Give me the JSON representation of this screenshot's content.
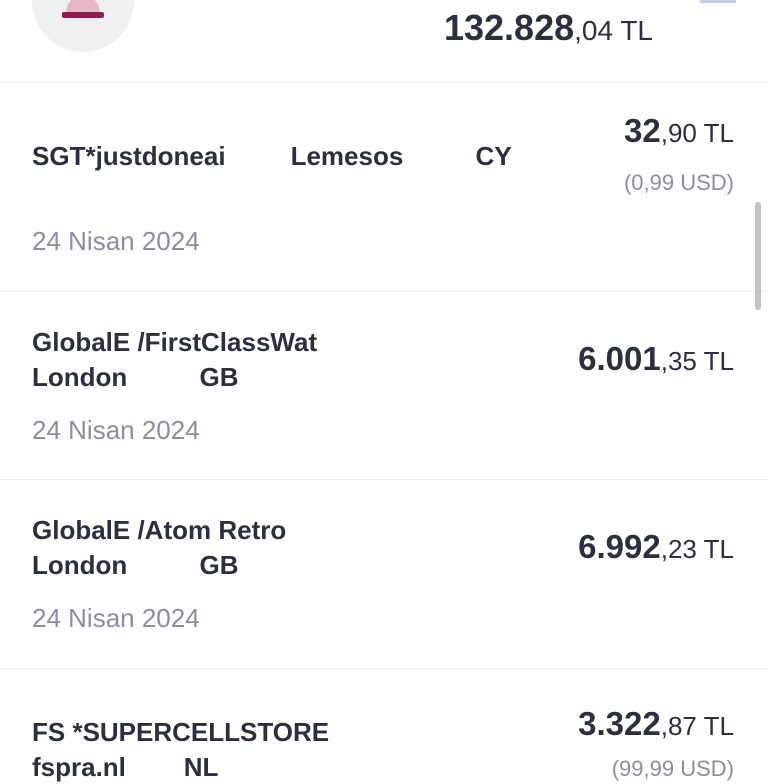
{
  "header": {
    "total_int": "132.828",
    "total_dec": ",04 TL"
  },
  "transactions": [
    {
      "merchant_line1": "SGT*justdoneai         Lemesos          CY",
      "merchant_line2": "",
      "date": "24 Nisan 2024",
      "amount_int": "32",
      "amount_dec": ",90 TL",
      "foreign": "(0,99 USD)"
    },
    {
      "merchant_line1": "GlobalE /FirstClassWat",
      "merchant_line2": "London          GB",
      "date": "24 Nisan 2024",
      "amount_int": "6.001",
      "amount_dec": ",35 TL",
      "foreign": ""
    },
    {
      "merchant_line1": "GlobalE /Atom Retro",
      "merchant_line2": "London          GB",
      "date": "24 Nisan 2024",
      "amount_int": "6.992",
      "amount_dec": ",23 TL",
      "foreign": ""
    },
    {
      "merchant_line1": "FS *SUPERCELLSTORE",
      "merchant_line2": "fspra.nl        NL",
      "date": "",
      "amount_int": "3.322",
      "amount_dec": ",87 TL",
      "foreign": "(99,99 USD)"
    }
  ],
  "colors": {
    "text": "#2c2f3e",
    "muted": "#8b8e9c",
    "icon_accent": "#8c1d4f"
  }
}
